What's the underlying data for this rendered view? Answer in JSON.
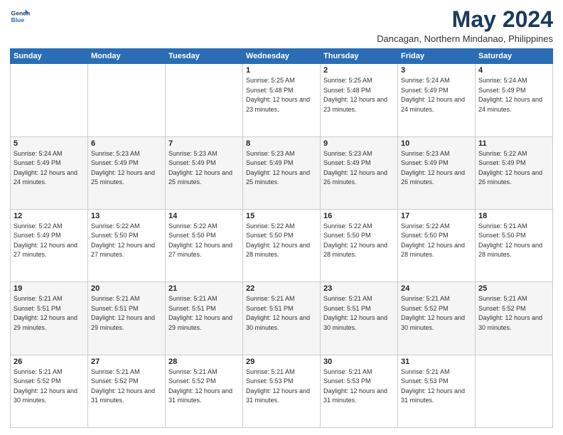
{
  "logo": {
    "line1": "General",
    "line2": "Blue"
  },
  "header": {
    "month": "May 2024",
    "location": "Dancagan, Northern Mindanao, Philippines"
  },
  "weekdays": [
    "Sunday",
    "Monday",
    "Tuesday",
    "Wednesday",
    "Thursday",
    "Friday",
    "Saturday"
  ],
  "weeks": [
    [
      {
        "day": "",
        "sunrise": "",
        "sunset": "",
        "daylight": ""
      },
      {
        "day": "",
        "sunrise": "",
        "sunset": "",
        "daylight": ""
      },
      {
        "day": "",
        "sunrise": "",
        "sunset": "",
        "daylight": ""
      },
      {
        "day": "1",
        "sunrise": "Sunrise: 5:25 AM",
        "sunset": "Sunset: 5:48 PM",
        "daylight": "Daylight: 12 hours and 23 minutes."
      },
      {
        "day": "2",
        "sunrise": "Sunrise: 5:25 AM",
        "sunset": "Sunset: 5:48 PM",
        "daylight": "Daylight: 12 hours and 23 minutes."
      },
      {
        "day": "3",
        "sunrise": "Sunrise: 5:24 AM",
        "sunset": "Sunset: 5:49 PM",
        "daylight": "Daylight: 12 hours and 24 minutes."
      },
      {
        "day": "4",
        "sunrise": "Sunrise: 5:24 AM",
        "sunset": "Sunset: 5:49 PM",
        "daylight": "Daylight: 12 hours and 24 minutes."
      }
    ],
    [
      {
        "day": "5",
        "sunrise": "Sunrise: 5:24 AM",
        "sunset": "Sunset: 5:49 PM",
        "daylight": "Daylight: 12 hours and 24 minutes."
      },
      {
        "day": "6",
        "sunrise": "Sunrise: 5:23 AM",
        "sunset": "Sunset: 5:49 PM",
        "daylight": "Daylight: 12 hours and 25 minutes."
      },
      {
        "day": "7",
        "sunrise": "Sunrise: 5:23 AM",
        "sunset": "Sunset: 5:49 PM",
        "daylight": "Daylight: 12 hours and 25 minutes."
      },
      {
        "day": "8",
        "sunrise": "Sunrise: 5:23 AM",
        "sunset": "Sunset: 5:49 PM",
        "daylight": "Daylight: 12 hours and 25 minutes."
      },
      {
        "day": "9",
        "sunrise": "Sunrise: 5:23 AM",
        "sunset": "Sunset: 5:49 PM",
        "daylight": "Daylight: 12 hours and 26 minutes."
      },
      {
        "day": "10",
        "sunrise": "Sunrise: 5:23 AM",
        "sunset": "Sunset: 5:49 PM",
        "daylight": "Daylight: 12 hours and 26 minutes."
      },
      {
        "day": "11",
        "sunrise": "Sunrise: 5:22 AM",
        "sunset": "Sunset: 5:49 PM",
        "daylight": "Daylight: 12 hours and 26 minutes."
      }
    ],
    [
      {
        "day": "12",
        "sunrise": "Sunrise: 5:22 AM",
        "sunset": "Sunset: 5:49 PM",
        "daylight": "Daylight: 12 hours and 27 minutes."
      },
      {
        "day": "13",
        "sunrise": "Sunrise: 5:22 AM",
        "sunset": "Sunset: 5:50 PM",
        "daylight": "Daylight: 12 hours and 27 minutes."
      },
      {
        "day": "14",
        "sunrise": "Sunrise: 5:22 AM",
        "sunset": "Sunset: 5:50 PM",
        "daylight": "Daylight: 12 hours and 27 minutes."
      },
      {
        "day": "15",
        "sunrise": "Sunrise: 5:22 AM",
        "sunset": "Sunset: 5:50 PM",
        "daylight": "Daylight: 12 hours and 28 minutes."
      },
      {
        "day": "16",
        "sunrise": "Sunrise: 5:22 AM",
        "sunset": "Sunset: 5:50 PM",
        "daylight": "Daylight: 12 hours and 28 minutes."
      },
      {
        "day": "17",
        "sunrise": "Sunrise: 5:22 AM",
        "sunset": "Sunset: 5:50 PM",
        "daylight": "Daylight: 12 hours and 28 minutes."
      },
      {
        "day": "18",
        "sunrise": "Sunrise: 5:21 AM",
        "sunset": "Sunset: 5:50 PM",
        "daylight": "Daylight: 12 hours and 28 minutes."
      }
    ],
    [
      {
        "day": "19",
        "sunrise": "Sunrise: 5:21 AM",
        "sunset": "Sunset: 5:51 PM",
        "daylight": "Daylight: 12 hours and 29 minutes."
      },
      {
        "day": "20",
        "sunrise": "Sunrise: 5:21 AM",
        "sunset": "Sunset: 5:51 PM",
        "daylight": "Daylight: 12 hours and 29 minutes."
      },
      {
        "day": "21",
        "sunrise": "Sunrise: 5:21 AM",
        "sunset": "Sunset: 5:51 PM",
        "daylight": "Daylight: 12 hours and 29 minutes."
      },
      {
        "day": "22",
        "sunrise": "Sunrise: 5:21 AM",
        "sunset": "Sunset: 5:51 PM",
        "daylight": "Daylight: 12 hours and 30 minutes."
      },
      {
        "day": "23",
        "sunrise": "Sunrise: 5:21 AM",
        "sunset": "Sunset: 5:51 PM",
        "daylight": "Daylight: 12 hours and 30 minutes."
      },
      {
        "day": "24",
        "sunrise": "Sunrise: 5:21 AM",
        "sunset": "Sunset: 5:52 PM",
        "daylight": "Daylight: 12 hours and 30 minutes."
      },
      {
        "day": "25",
        "sunrise": "Sunrise: 5:21 AM",
        "sunset": "Sunset: 5:52 PM",
        "daylight": "Daylight: 12 hours and 30 minutes."
      }
    ],
    [
      {
        "day": "26",
        "sunrise": "Sunrise: 5:21 AM",
        "sunset": "Sunset: 5:52 PM",
        "daylight": "Daylight: 12 hours and 30 minutes."
      },
      {
        "day": "27",
        "sunrise": "Sunrise: 5:21 AM",
        "sunset": "Sunset: 5:52 PM",
        "daylight": "Daylight: 12 hours and 31 minutes."
      },
      {
        "day": "28",
        "sunrise": "Sunrise: 5:21 AM",
        "sunset": "Sunset: 5:52 PM",
        "daylight": "Daylight: 12 hours and 31 minutes."
      },
      {
        "day": "29",
        "sunrise": "Sunrise: 5:21 AM",
        "sunset": "Sunset: 5:53 PM",
        "daylight": "Daylight: 12 hours and 31 minutes."
      },
      {
        "day": "30",
        "sunrise": "Sunrise: 5:21 AM",
        "sunset": "Sunset: 5:53 PM",
        "daylight": "Daylight: 12 hours and 31 minutes."
      },
      {
        "day": "31",
        "sunrise": "Sunrise: 5:21 AM",
        "sunset": "Sunset: 5:53 PM",
        "daylight": "Daylight: 12 hours and 31 minutes."
      },
      {
        "day": "",
        "sunrise": "",
        "sunset": "",
        "daylight": ""
      }
    ]
  ]
}
